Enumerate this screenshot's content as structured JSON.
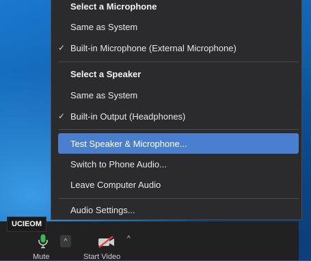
{
  "menu": {
    "microphone_header": "Select a Microphone",
    "microphone_items": [
      {
        "label": "Same as System",
        "checked": false
      },
      {
        "label": "Built-in Microphone (External Microphone)",
        "checked": true
      }
    ],
    "speaker_header": "Select a Speaker",
    "speaker_items": [
      {
        "label": "Same as System",
        "checked": false
      },
      {
        "label": "Built-in Output (Headphones)",
        "checked": true
      }
    ],
    "actions": [
      {
        "label": "Test Speaker & Microphone...",
        "highlighted": true
      },
      {
        "label": "Switch to Phone Audio...",
        "highlighted": false
      },
      {
        "label": "Leave Computer Audio",
        "highlighted": false
      }
    ],
    "settings_label": "Audio Settings...",
    "check_glyph": "✓",
    "highlight_color": "#4a7fcf"
  },
  "toolbar": {
    "tooltip": "UCIEOM",
    "mute_label": "Mute",
    "start_video_label": "Start Video",
    "caret_glyph": "^",
    "mic_icon": "microphone-icon",
    "video_icon": "video-off-icon"
  }
}
